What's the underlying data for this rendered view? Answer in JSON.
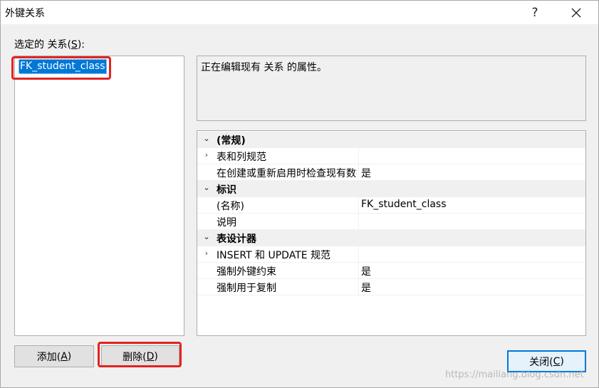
{
  "window": {
    "title": "外键关系",
    "help_label": "?",
    "close_icon": "close-icon"
  },
  "relations": {
    "label": "选定的 关系(",
    "label_key": "S",
    "label_tail": "):",
    "items": [
      {
        "label": "FK_student_class",
        "selected": true
      }
    ]
  },
  "description": {
    "text": "正在编辑现有 关系 的属性。"
  },
  "properties": {
    "rows": [
      {
        "type": "category",
        "toggle": "⌄",
        "name": "(常规)",
        "value": ""
      },
      {
        "type": "prop",
        "toggle": "›",
        "name": "表和列规范",
        "value": ""
      },
      {
        "type": "prop",
        "toggle": "",
        "name": "在创建或重新启用时检查现有数据",
        "value": "是"
      },
      {
        "type": "category",
        "toggle": "⌄",
        "name": "标识",
        "value": ""
      },
      {
        "type": "prop",
        "toggle": "",
        "name": "(名称)",
        "value": "FK_student_class"
      },
      {
        "type": "prop",
        "toggle": "",
        "name": "说明",
        "value": ""
      },
      {
        "type": "category",
        "toggle": "⌄",
        "name": "表设计器",
        "value": ""
      },
      {
        "type": "prop",
        "toggle": "›",
        "name": "INSERT 和 UPDATE 规范",
        "value": ""
      },
      {
        "type": "prop",
        "toggle": "",
        "name": "强制外键约束",
        "value": "是"
      },
      {
        "type": "prop",
        "toggle": "",
        "name": "强制用于复制",
        "value": "是"
      }
    ]
  },
  "buttons": {
    "add": {
      "label": "添加(",
      "key": "A",
      "tail": ")"
    },
    "delete": {
      "label": "删除(",
      "key": "D",
      "tail": ")"
    },
    "close": {
      "label": "关闭(",
      "key": "C",
      "tail": ")"
    }
  },
  "watermark": "https://mailiang.blog.csdn.net",
  "colors": {
    "selection": "#0078d7",
    "highlight": "#e3231f",
    "dialog_bg": "#f0f0f0"
  }
}
